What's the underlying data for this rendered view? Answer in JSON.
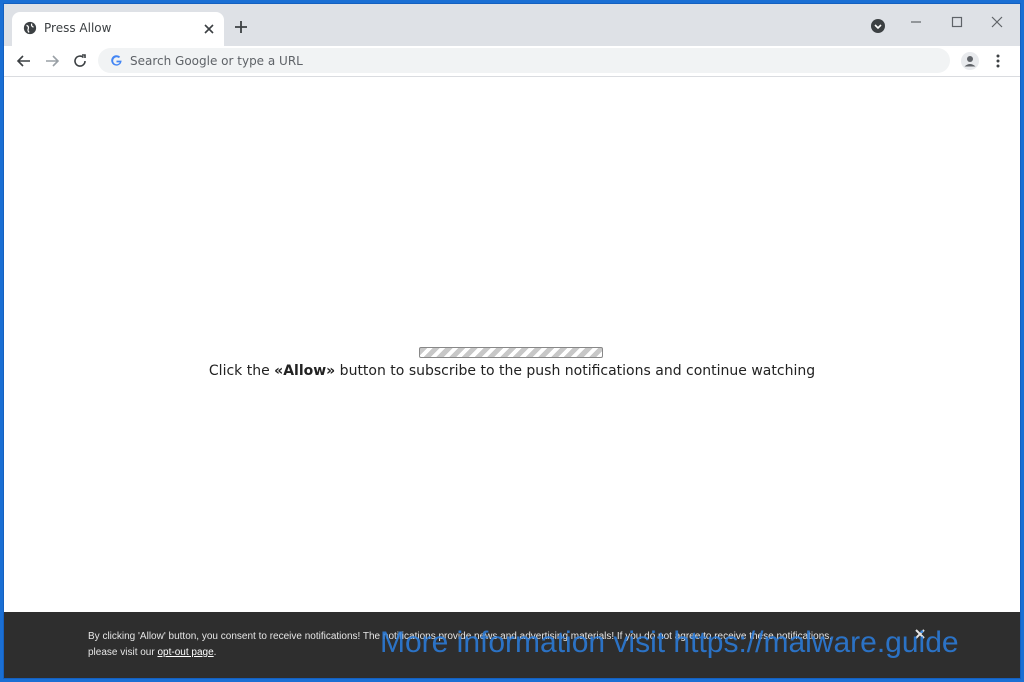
{
  "browser": {
    "tab": {
      "title": "Press Allow",
      "favicon": "globe-icon",
      "close_icon": "close-icon"
    },
    "new_tab_icon": "plus-icon",
    "window_controls": [
      "download-indicator-icon",
      "minimize-icon",
      "maximize-icon",
      "close-window-icon"
    ],
    "omnibox": {
      "placeholder": "Search Google or type a URL",
      "value": ""
    },
    "nav_icons": [
      "back-arrow-icon",
      "forward-arrow-icon",
      "reload-icon"
    ],
    "profile_icon": "account-icon",
    "menu_icon": "kebab-menu-icon"
  },
  "page": {
    "progress_fraction": 1.0,
    "message_before": "Click the ",
    "message_bold": "«Allow»",
    "message_after": " button to subscribe to the push notifications and continue watching"
  },
  "notification_bar": {
    "text": "By clicking 'Allow' button, you consent to receive notifications! The notifications provide news and advertising materials! If you do not agree to receive these notifications,",
    "text2_before": "please visit our ",
    "link": "opt-out page",
    "text2_after": ".",
    "close_icon": "close-icon"
  },
  "watermark": "More information visit https://malware.guide",
  "colors": {
    "frame_border": "#1a6fd4",
    "tabstrip": "#dee1e6",
    "notification_bg": "#2e2e2e",
    "watermark": "#2b7fe0"
  }
}
